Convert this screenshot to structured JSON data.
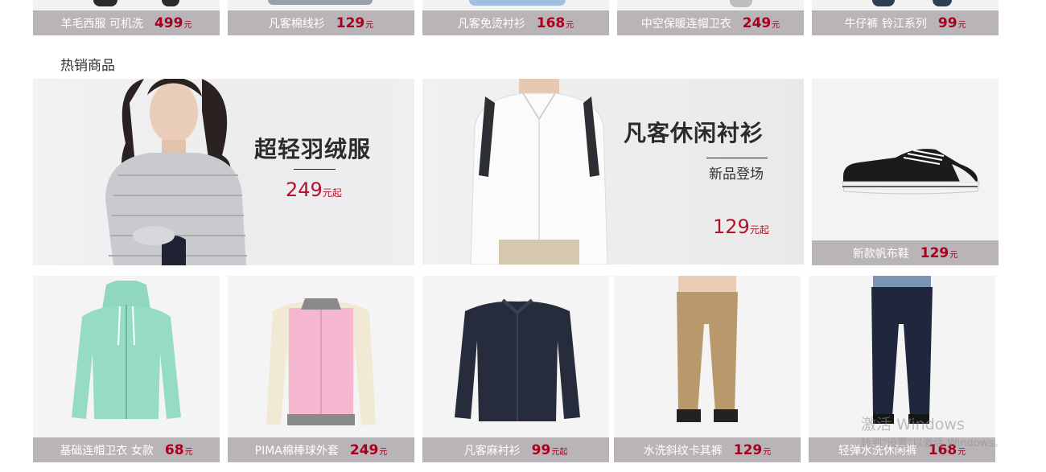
{
  "top_products": [
    {
      "name": "羊毛西服 可机洗",
      "price": "499",
      "unit": "元"
    },
    {
      "name": "凡客棉线衫",
      "price": "129",
      "unit": "元"
    },
    {
      "name": "凡客免烫衬衫",
      "price": "168",
      "unit": "元"
    },
    {
      "name": "中空保暖连帽卫衣",
      "price": "249",
      "unit": "元"
    },
    {
      "name": "牛仔裤 铃江系列",
      "price": "99",
      "unit": "元"
    }
  ],
  "section": {
    "title": "热销商品"
  },
  "banners": [
    {
      "title": "超轻羽绒服",
      "price": "249",
      "unit": "元起"
    },
    {
      "title": "凡客休闲衬衫",
      "subtitle": "新品登场",
      "price": "129",
      "unit": "元起"
    },
    {
      "name": "新款帆布鞋",
      "price": "129",
      "unit": "元"
    }
  ],
  "bottom_products": [
    {
      "name": "基础连帽卫衣 女款",
      "price": "68",
      "unit": "元"
    },
    {
      "name": "PIMA棉棒球外套",
      "price": "249",
      "unit": "元"
    },
    {
      "name": "凡客麻衬衫",
      "price": "99",
      "unit": "元起"
    },
    {
      "name": "水洗斜纹卡其裤",
      "price": "129",
      "unit": "元"
    },
    {
      "name": "轻弹水洗休闲裤",
      "price": "168",
      "unit": "元"
    }
  ],
  "watermark": {
    "line1": "激活 Windows",
    "line2": "转到\"设置\"以激活 Windows。"
  },
  "colors": {
    "caption_bg": "#b9b4b8",
    "price_red": "#a8001d",
    "banner_red": "#b3122c"
  }
}
